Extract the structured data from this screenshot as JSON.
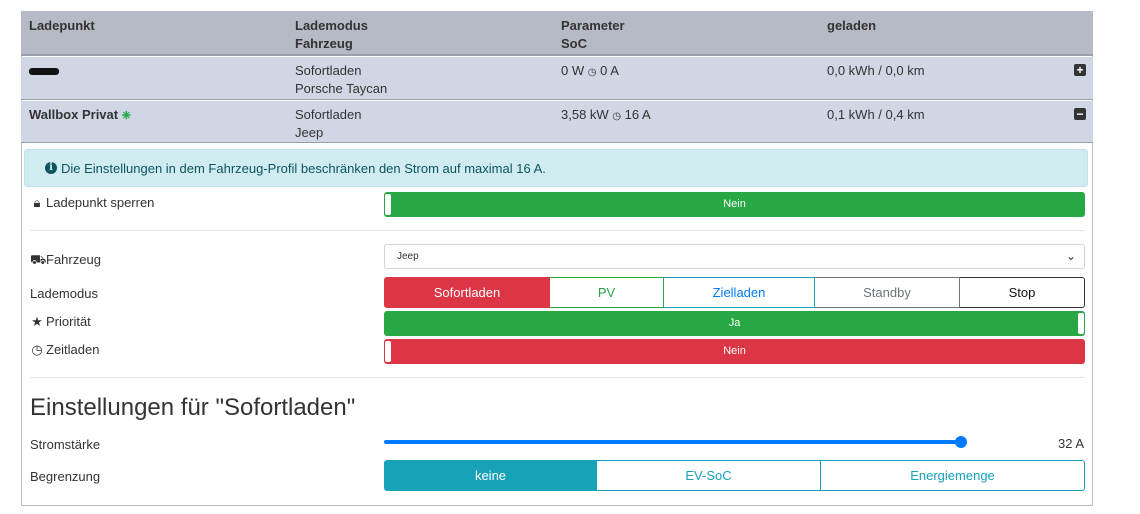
{
  "table": {
    "headers": {
      "col1": "Ladepunkt",
      "col2_line1": "Lademodus",
      "col2_line2": "Fahrzeug",
      "col3_line1": "Parameter",
      "col3_line2": "SoC",
      "col4": "geladen"
    },
    "rows": [
      {
        "name": "",
        "mode": "Sofortladen",
        "vehicle": "Porsche Taycan",
        "power": "0 W",
        "current": "0 A",
        "charged": "0,0 kWh / 0,0 km",
        "expand_symbol": "+"
      },
      {
        "name": "Wallbox Privat",
        "mode": "Sofortladen",
        "vehicle": "Jeep",
        "power": "3,58 kW",
        "current": "16 A",
        "charged": "0,1 kWh / 0,4 km",
        "expand_symbol": "−"
      }
    ]
  },
  "alert": {
    "text": "Die Einstellungen in dem Fahrzeug-Profil beschränken den Strom auf maximal 16 A."
  },
  "settings": {
    "lock": {
      "label": "Ladepunkt sperren",
      "value": "Nein"
    },
    "vehicle": {
      "label": "Fahrzeug",
      "selected": "Jeep"
    },
    "mode": {
      "label": "Lademodus",
      "options": [
        "Sofortladen",
        "PV",
        "Zielladen",
        "Standby",
        "Stop"
      ],
      "active": "Sofortladen"
    },
    "priority": {
      "label": "Priorität",
      "value": "Ja"
    },
    "timed": {
      "label": "Zeitladen",
      "value": "Nein"
    }
  },
  "section": {
    "title": "Einstellungen für \"Sofortladen\"",
    "current": {
      "label": "Stromstärke",
      "value": "32 A",
      "fraction": 1.0
    },
    "limit": {
      "label": "Begrenzung",
      "options": [
        "keine",
        "EV-SoC",
        "Energiemenge"
      ],
      "active": "keine"
    }
  },
  "colors": {
    "header_bg": "#b6bac4",
    "row_bg": "#d0d6e4",
    "green": "#28a745",
    "red": "#dc3545",
    "info": "#17a2b8",
    "blue": "#007bff"
  }
}
